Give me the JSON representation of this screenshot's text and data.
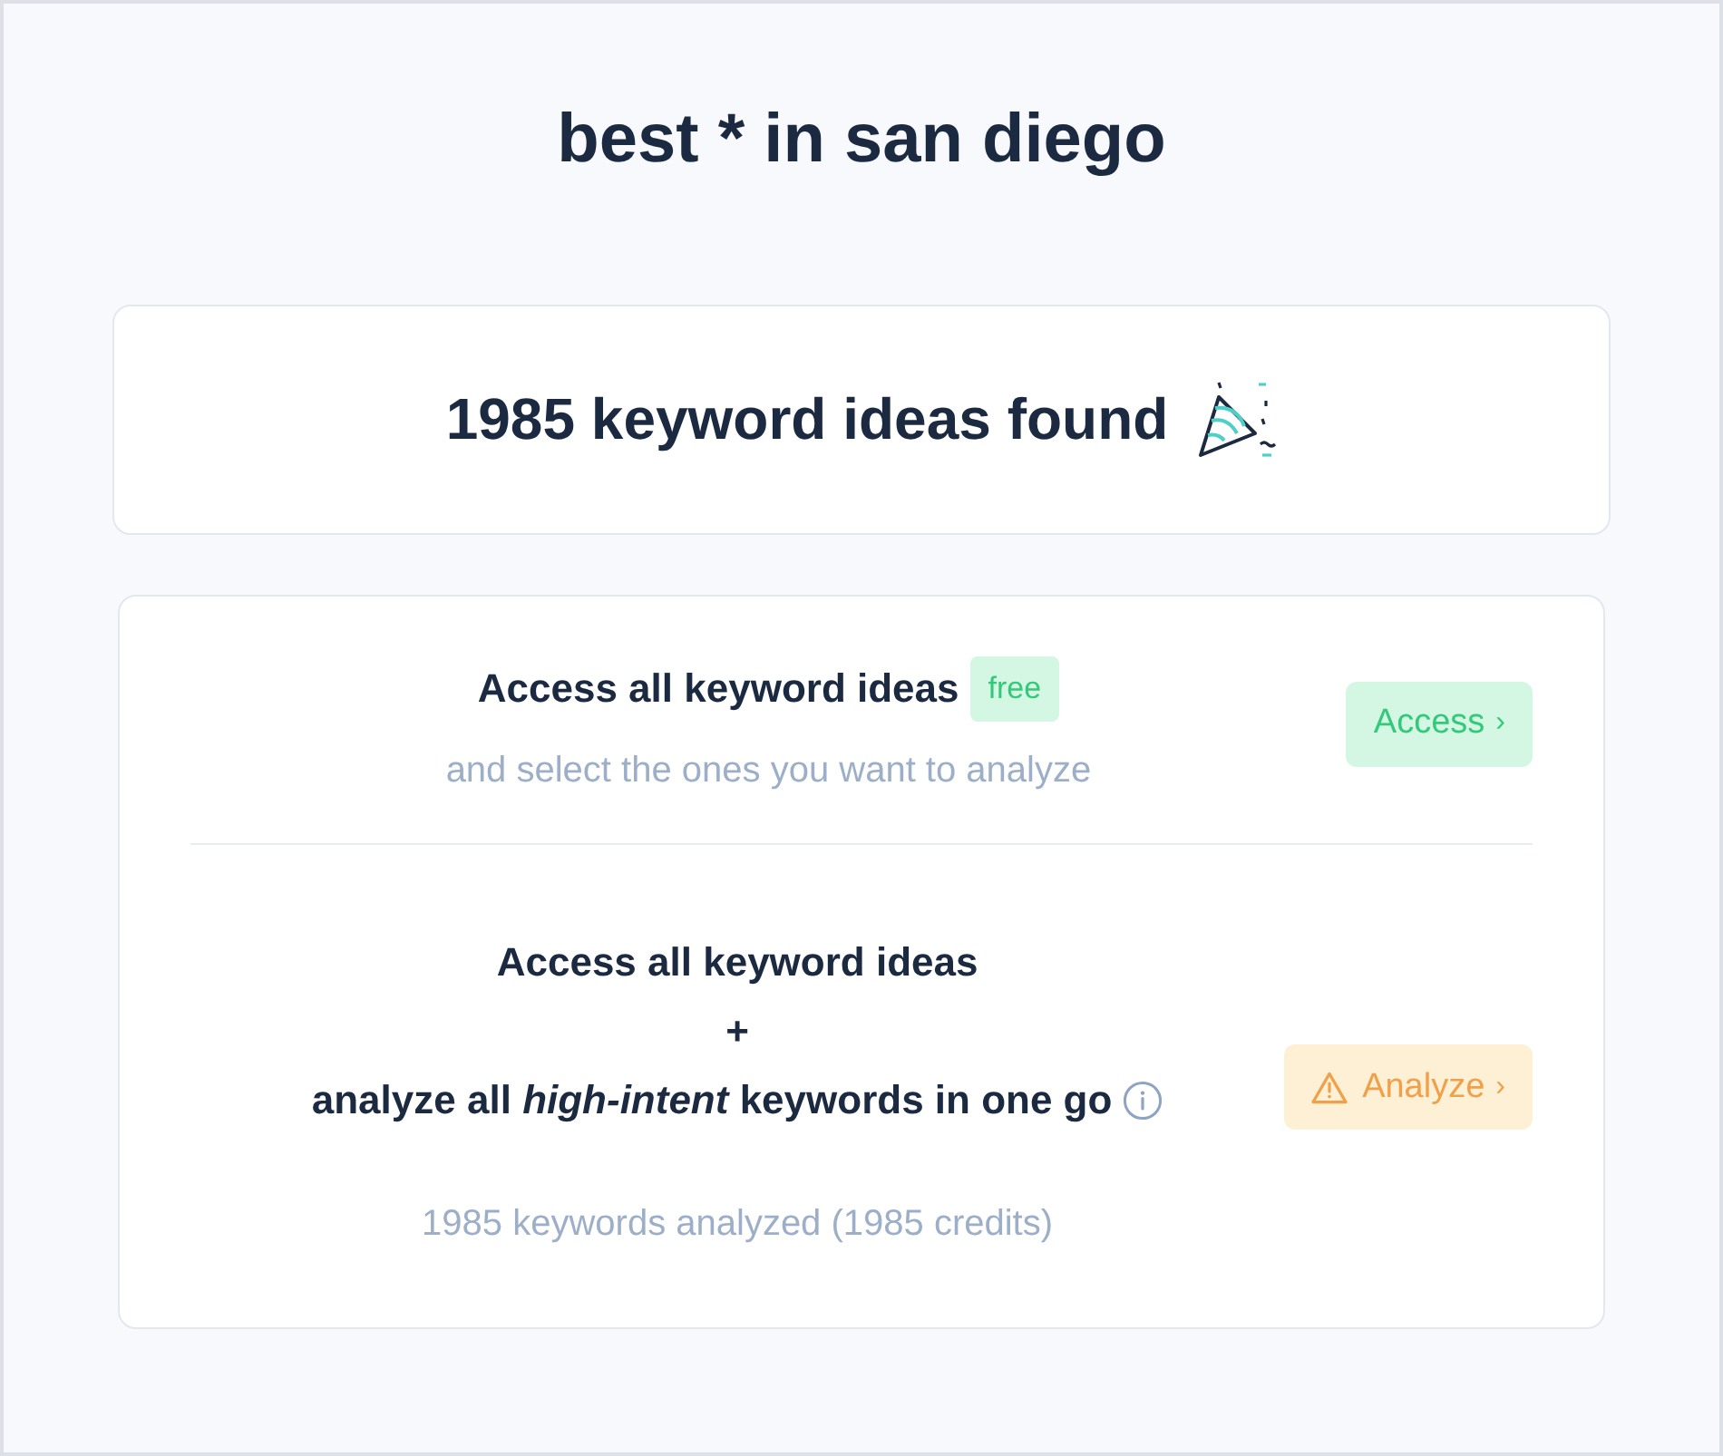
{
  "page_title": "best * in san diego",
  "summary": {
    "text": "1985 keyword ideas found",
    "celebration": true
  },
  "options": [
    {
      "kind": "access",
      "lines": [
        "Access all keyword ideas"
      ],
      "badge": "free",
      "subtitle": "and select the ones you want to analyze",
      "button": {
        "label": "Access",
        "chevron": "›"
      }
    },
    {
      "kind": "analyze",
      "lines": [
        "Access all keyword ideas",
        "+",
        "analyze all *high-intent* keywords in one go"
      ],
      "subtitle": "1985 keywords analyzed (1985 credits)",
      "info": true,
      "button": {
        "label": "Analyze",
        "chevron": "›",
        "warning": true
      }
    }
  ]
}
